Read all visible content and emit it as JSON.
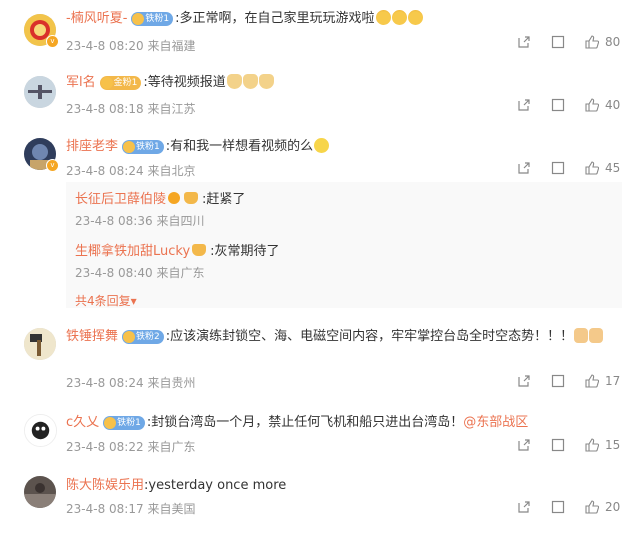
{
  "comments": [
    {
      "name": "-楠风听夏-",
      "badge": "铁粉1",
      "text": ":多正常啊，在自己家里玩玩游戏啦",
      "time": "23-4-8 08:20",
      "loc": "来自福建",
      "likes": "80",
      "avatar_color": "#f2c44a"
    },
    {
      "name": "军l名",
      "badge": "金粉1",
      "text": ":等待视频报道",
      "time": "23-4-8 08:18",
      "loc": "来自江苏",
      "likes": "40",
      "avatar_color": "#9fb6c8"
    },
    {
      "name": "排座老李",
      "badge": "铁粉1",
      "text": ":有和我一样想看视频的么",
      "time": "23-4-8 08:24",
      "loc": "来自北京",
      "likes": "45",
      "avatar_color": "#3c4b6e"
    },
    {
      "name": "铁锤挥舞",
      "badge": "铁粉2",
      "text": ":应该演练封锁空、海、电磁空间内容，牢牢掌控台岛全时空态势！！！",
      "time": "23-4-8 08:24",
      "loc": "来自贵州",
      "likes": "17",
      "avatar_color": "#e7d8b0"
    },
    {
      "name": "c久乂",
      "badge": "铁粉1",
      "text": ":封锁台湾岛一个月，禁止任何飞机和船只进出台湾岛！",
      "link": "@东部战区",
      "time": "23-4-8 08:22",
      "loc": "来自广东",
      "likes": "15",
      "avatar_color": "#ffffff"
    },
    {
      "name": "陈大陈娱乐用",
      "text": ":yesterday once more",
      "time": "23-4-8 08:17",
      "loc": "来自美国",
      "likes": "20",
      "avatar_color": "#6a5f5a"
    }
  ],
  "replies": [
    {
      "name": "长征后卫薛伯陵",
      "text": ":赶紧了",
      "time": "23-4-8 08:36",
      "loc": "来自四川"
    },
    {
      "name": "生椰拿铁加甜Lucky",
      "text": ":灰常期待了",
      "time": "23-4-8 08:40",
      "loc": "来自广东"
    }
  ],
  "more_replies": "共4条回复",
  "icons": {
    "share": "share-icon",
    "comment": "comment-icon",
    "like": "thumbs-up-icon",
    "more": "caret-down-icon"
  },
  "colors": {
    "username": "#eb7350",
    "meta": "#999999"
  }
}
